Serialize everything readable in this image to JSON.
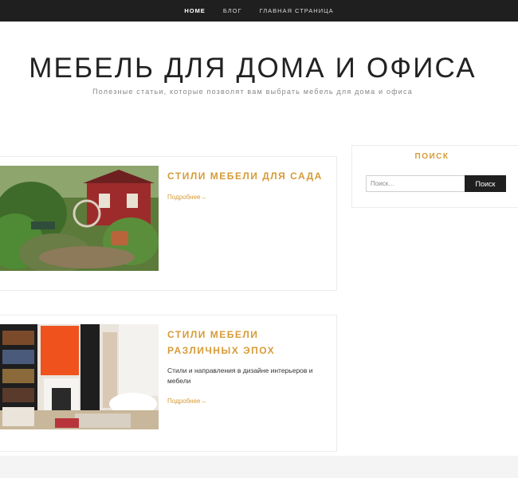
{
  "nav": {
    "items": [
      {
        "label": "Home",
        "active": true
      },
      {
        "label": "Блог",
        "active": false
      },
      {
        "label": "Главная страница",
        "active": false
      }
    ]
  },
  "header": {
    "title": "МЕБЕЛЬ ДЛЯ ДОМА И ОФИСА",
    "description": "Полезные статьи, которые позволят вам выбрать мебель для дома и офиса"
  },
  "posts": [
    {
      "title": "Стили мебели для сада",
      "excerpt": "",
      "read_more": "Подробнее→"
    },
    {
      "title": "Стили мебели различных эпох",
      "excerpt": "Стили и направления в дизайне интерьеров и мебели",
      "read_more": "Подробнее→"
    }
  ],
  "sidebar": {
    "search_widget": {
      "title": "Поиск",
      "placeholder": "Поиск…",
      "button_label": "Поиск"
    }
  },
  "colors": {
    "accent": "#d79b37",
    "nav_bg": "#1f1f1f",
    "button_bg": "#1f1f1f"
  }
}
